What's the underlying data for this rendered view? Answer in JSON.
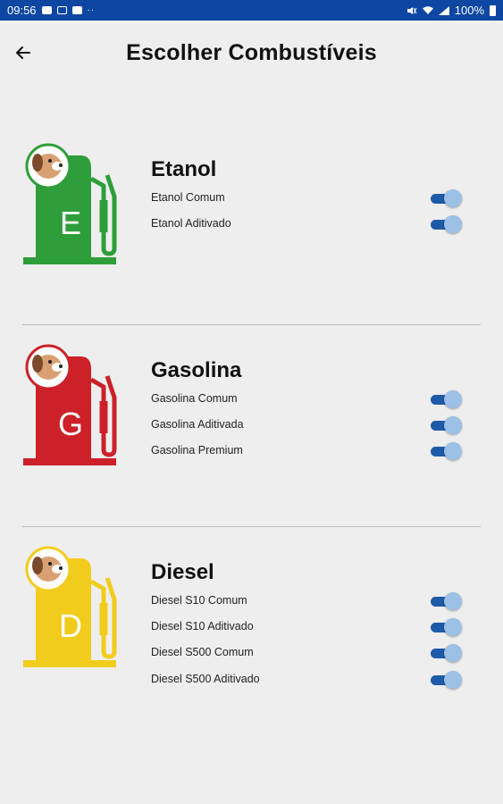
{
  "status_bar": {
    "time": "09:56",
    "battery": "100%"
  },
  "header": {
    "title": "Escolher Combustíveis",
    "back_icon": "arrow-left-icon"
  },
  "sections": [
    {
      "title": "Etanol",
      "letter": "E",
      "color": "#2e9e3a",
      "options": [
        {
          "label": "Etanol Comum",
          "enabled": true
        },
        {
          "label": "Etanol Aditivado",
          "enabled": true
        }
      ]
    },
    {
      "title": "Gasolina",
      "letter": "G",
      "color": "#cc2128",
      "options": [
        {
          "label": "Gasolina Comum",
          "enabled": true
        },
        {
          "label": "Gasolina Aditivada",
          "enabled": true
        },
        {
          "label": "Gasolina Premium",
          "enabled": true
        }
      ]
    },
    {
      "title": "Diesel",
      "letter": "D",
      "color": "#f2cc1c",
      "options": [
        {
          "label": "Diesel S10 Comum",
          "enabled": true
        },
        {
          "label": "Diesel S10 Aditivado",
          "enabled": true
        },
        {
          "label": "Diesel S500 Comum",
          "enabled": true
        },
        {
          "label": "Diesel S500 Aditivado",
          "enabled": true
        }
      ]
    }
  ],
  "colors": {
    "status_bar": "#0d47a1",
    "toggle_track": "#1e5aa8",
    "toggle_thumb": "#9cc0e6",
    "background": "#eeeeee"
  }
}
